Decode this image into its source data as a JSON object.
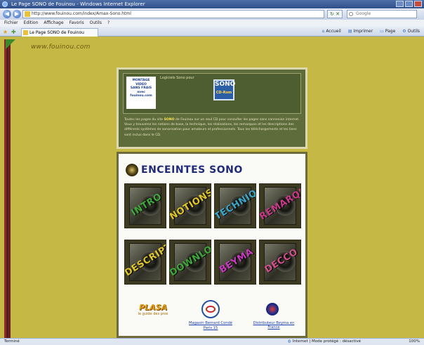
{
  "window": {
    "title": "Le Page SONO de Fouinou - Windows Internet Explorer"
  },
  "address": {
    "url": "http://www.fouinou.com/index/Amax-Sono.html",
    "search_placeholder": "Google"
  },
  "menu": [
    "Fichier",
    "Edition",
    "Affichage",
    "Favoris",
    "Outils",
    "?"
  ],
  "tab": {
    "label": "Le Page SONO de Fouinou"
  },
  "commands": [
    "Accueil",
    "Imprimer",
    "Page",
    "Outils"
  ],
  "page": {
    "site_logo": "www.fouinou.com",
    "promo": {
      "left_text": [
        "MONTAGE",
        "VIDEO",
        "SANS FRAIS",
        "avec",
        "fouinou.com"
      ],
      "small_label": "Logiciels Sono pour",
      "badge_main": "SONO",
      "badge_sub": "CD-Rom",
      "body_pre": "Toutes les pages du site ",
      "body_bold": "SONO",
      "body_post": " de Fouinou sur un seul CD pour consulter les pages sans connexion internet. Vous y trouverez les notions de base, la technique, les réalisations, les remarques et les descriptions des différents systèmes de sonorisation pour amateurs et professionnels. Tous les téléchargements et les liens sont inclus dans le CD."
    },
    "enceintes": {
      "title": "ENCEINTES SONO",
      "tiles": [
        {
          "label": "INTRO",
          "color": "#3fa83a"
        },
        {
          "label": "NOTIONS",
          "color": "#e0c62a"
        },
        {
          "label": "TECHNIQUE",
          "color": "#3aa6c8"
        },
        {
          "label": "REMARQUES",
          "color": "#c93a8a"
        },
        {
          "label": "DESCRIPTION",
          "color": "#e0c62a"
        },
        {
          "label": "DOWNLOAD",
          "color": "#3fa83a"
        },
        {
          "label": "BEYMA",
          "color": "#c93ac0"
        },
        {
          "label": "DECCO",
          "color": "#d04f8c"
        }
      ],
      "plasa_title": "PLASA",
      "plasa_sub": "le guide des pros",
      "magasin_link": "Magasin Bernard Condé Paris 15",
      "beyma_link": "Distributeur Beyma en France"
    }
  },
  "status": {
    "left": "Terminé",
    "zone": "Internet | Mode protégé : désactivé",
    "zoom": "100%"
  }
}
